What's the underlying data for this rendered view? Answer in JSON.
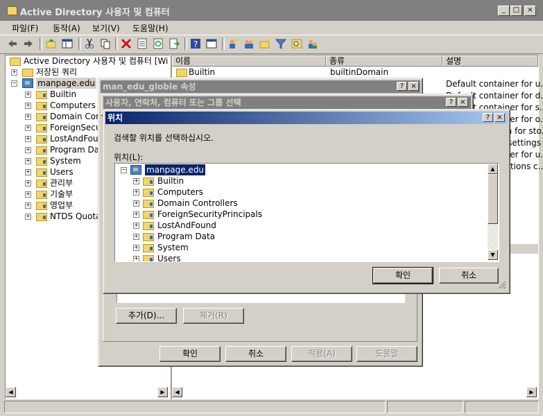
{
  "window": {
    "title": "Active Directory 사용자 및 컴퓨터",
    "min": "_",
    "max": "□",
    "close": "×"
  },
  "menu": {
    "file": "파일(F)",
    "action": "동작(A)",
    "view": "보기(V)",
    "help": "도움말(H)"
  },
  "toolbar_icons": [
    "back-icon",
    "forward-icon",
    "up-icon",
    "show-tree-icon",
    "cut-icon",
    "copy-icon",
    "delete-icon",
    "properties-icon",
    "refresh-icon",
    "export-icon",
    "help-icon",
    "console-icon",
    "new-user-icon",
    "new-group-icon",
    "new-ou-icon",
    "filter-icon",
    "find-icon",
    "add-to-group-icon"
  ],
  "tree": {
    "root": "Active Directory 사용자 및 컴퓨터 [Wi",
    "saved_queries": "저장된 쿼리",
    "domain": "manpage.edu",
    "children": [
      "Builtin",
      "Computers",
      "Domain Con",
      "ForeignSecu",
      "LostAndFoun",
      "Program Dat",
      "System",
      "Users",
      "관리부",
      "기술부",
      "영업부",
      "NTDS Quota"
    ]
  },
  "list": {
    "columns": {
      "name": "이름",
      "type": "종류",
      "desc": "설명"
    },
    "rows": [
      {
        "name": "Builtin",
        "type": "builtinDomain",
        "desc": ""
      },
      {
        "name": "",
        "type": "",
        "desc": "Default container for u..."
      },
      {
        "name": "",
        "type": "",
        "desc": "Default container for d..."
      },
      {
        "name": "",
        "type": "",
        "desc": "Default container for s..."
      },
      {
        "name": "",
        "type": "",
        "desc": "Default container for o..."
      },
      {
        "name": "",
        "type": "",
        "desc": "Default location for sto..."
      },
      {
        "name": "",
        "type": "",
        "desc": "Builtin system settings"
      },
      {
        "name": "",
        "type": "",
        "desc": "Default container for u..."
      },
      {
        "name": "",
        "type": "",
        "desc": "Quota specifications c..."
      }
    ]
  },
  "props_dialog": {
    "title": "man_edu_globle 속성",
    "add_label": "추가(D)...",
    "remove_label": "제거(R)",
    "ok_label": "확인",
    "cancel_label": "취소",
    "apply_label": "적용(A)",
    "help_label": "도움말"
  },
  "select_dialog": {
    "title": "사용자, 연락처, 컴퓨터 또는 그룹 선택"
  },
  "location_dialog": {
    "title": "위치",
    "instruction": "검색할 위치를 선택하십시오.",
    "location_label": "위치(L):",
    "tree_root": "manpage.edu",
    "tree_items": [
      "Builtin",
      "Computers",
      "Domain Controllers",
      "ForeignSecurityPrincipals",
      "LostAndFound",
      "Program Data",
      "System",
      "Users"
    ],
    "ok_label": "확인",
    "cancel_label": "취소",
    "help_btn": "?",
    "close_btn": "×"
  }
}
